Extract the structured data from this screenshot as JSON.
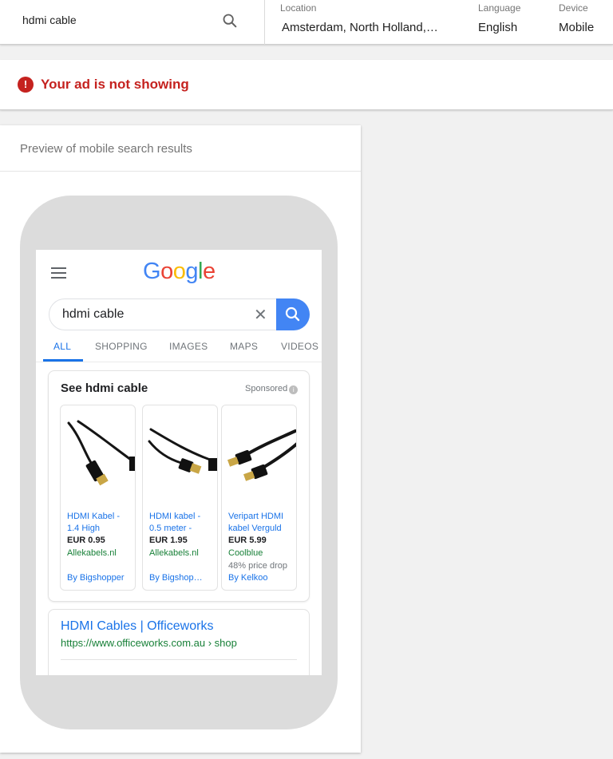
{
  "search": {
    "query": "hdmi cable"
  },
  "location": {
    "label": "Location",
    "value": "Amsterdam, North Holland, N…"
  },
  "language": {
    "label": "Language",
    "value": "English"
  },
  "device": {
    "label": "Device",
    "value": "Mobile"
  },
  "status": {
    "icon": "!",
    "text": "Your ad is not showing",
    "color": "#c5221f"
  },
  "preview": {
    "title": "Preview of mobile search results",
    "google_search": {
      "query": "hdmi cable"
    },
    "tabs": [
      {
        "label": "ALL",
        "active": true
      },
      {
        "label": "SHOPPING"
      },
      {
        "label": "IMAGES"
      },
      {
        "label": "MAPS"
      },
      {
        "label": "VIDEOS"
      }
    ],
    "shopping": {
      "title": "See hdmi cable",
      "sponsored": "Sponsored",
      "products": [
        {
          "name_line1": "HDMI Kabel -",
          "name_line2": "1.4 High",
          "price": "EUR 0.95",
          "merchant": "Allekabels.nl",
          "note": "",
          "by": "By Bigshopper"
        },
        {
          "name_line1": "HDMI kabel -",
          "name_line2": "0.5 meter -",
          "price": "EUR 1.95",
          "merchant": "Allekabels.nl",
          "note": "",
          "by": "By Bigshop…"
        },
        {
          "name_line1": "Veripart HDMI",
          "name_line2": "kabel Verguld",
          "price": "EUR 5.99",
          "merchant": "Coolblue",
          "note": "48% price drop",
          "by": "By Kelkoo"
        }
      ]
    },
    "organic": {
      "title": "HDMI Cables | Officeworks",
      "url": "https://www.officeworks.com.au › shop"
    }
  },
  "colors": {
    "google_blue": "#4285f4",
    "link_blue": "#1a73e8",
    "green": "#188038"
  }
}
